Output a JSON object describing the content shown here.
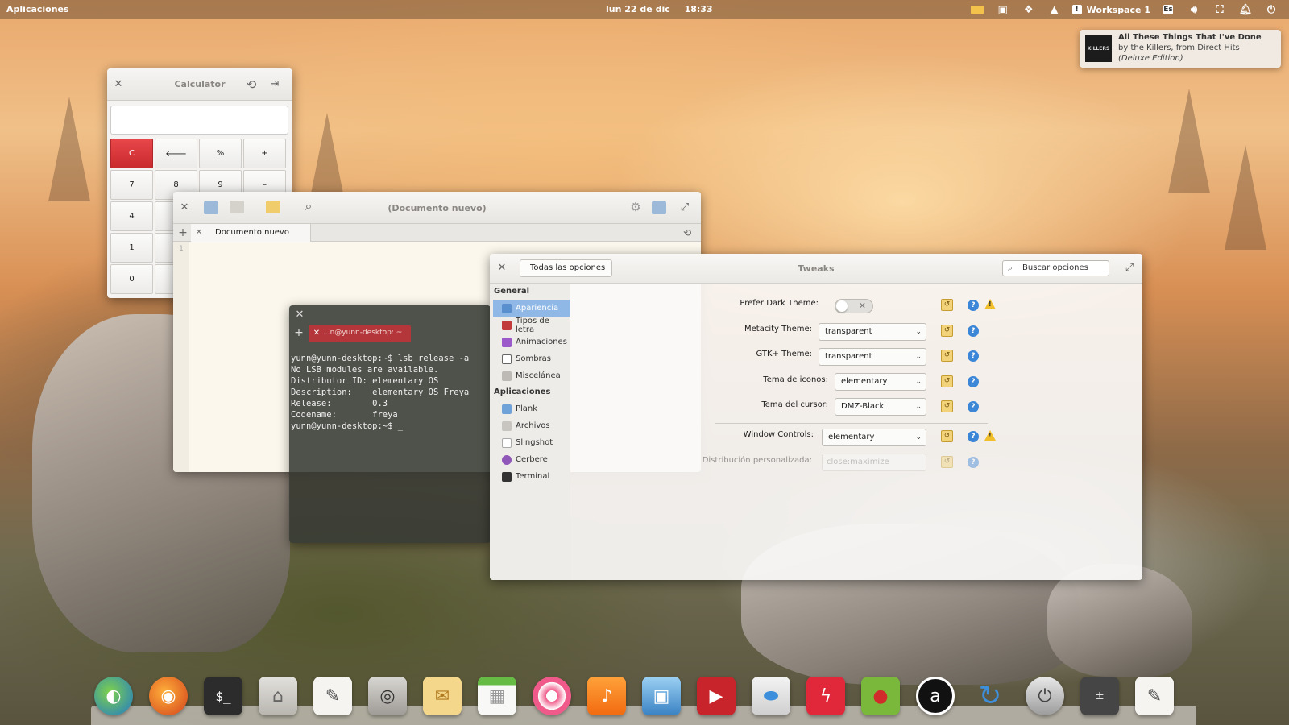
{
  "top_panel": {
    "apps_label": "Aplicaciones",
    "date": "lun 22 de dic",
    "time": "18:33",
    "workspace": "Workspace 1",
    "keyboard_layout": "Es"
  },
  "notification": {
    "song": "All These Things That I've Done",
    "artist_line": "by the Killers, from Direct Hits",
    "album_extra": "(Deluxe Edition)",
    "art_text": "KILLERS"
  },
  "calculator": {
    "title": "Calculator",
    "keys": [
      "C",
      "🡐",
      "%",
      "+",
      "7",
      "8",
      "9",
      "–",
      "4",
      "",
      "",
      "",
      "1",
      "",
      "",
      "",
      "0",
      "",
      "",
      ""
    ]
  },
  "editor": {
    "title": "(Documento nuevo)",
    "tab_label": "Documento nuevo",
    "line_number": "1"
  },
  "terminal": {
    "tab_label": "...n@yunn-desktop: ~",
    "lines": [
      "yunn@yunn-desktop:~$ lsb_release -a",
      "No LSB modules are available.",
      "Distributor ID: elementary OS",
      "Description:    elementary OS Freya",
      "Release:        0.3",
      "Codename:       freya",
      "yunn@yunn-desktop:~$ _"
    ]
  },
  "tweaks": {
    "title": "Tweaks",
    "back_label": "Todas las opciones",
    "search_placeholder": "Buscar opciones",
    "sidebar": {
      "general_header": "General",
      "general_items": [
        "Apariencia",
        "Tipos de letra",
        "Animaciones",
        "Sombras",
        "Miscelánea"
      ],
      "apps_header": "Aplicaciones",
      "apps_items": [
        "Plank",
        "Archivos",
        "Slingshot",
        "Cerbere",
        "Terminal"
      ]
    },
    "settings": {
      "dark_theme_label": "Prefer Dark Theme:",
      "metacity_label": "Metacity Theme:",
      "metacity_value": "transparent",
      "gtk_label": "GTK+ Theme:",
      "gtk_value": "transparent",
      "icons_label": "Tema de iconos:",
      "icons_value": "elementary",
      "cursor_label": "Tema del cursor:",
      "cursor_value": "DMZ-Black",
      "window_controls_label": "Window Controls:",
      "window_controls_value": "elementary",
      "custom_layout_label": "Distribución personalizada:",
      "custom_layout_value": "close:maximize"
    }
  },
  "dock": {
    "apps": [
      "midori",
      "firefox",
      "terminal",
      "files",
      "text-editor",
      "camera",
      "mail",
      "calendar",
      "lollypop",
      "music",
      "shotwell",
      "videos",
      "switchboard",
      "flash",
      "ladybug",
      "amazon",
      "updater",
      "power",
      "calculator",
      "scratch"
    ]
  },
  "colors": {
    "accent_blue": "#8fb8e6",
    "calc_clear_red": "#d6393c",
    "terminal_tab_red": "#b5363a"
  }
}
